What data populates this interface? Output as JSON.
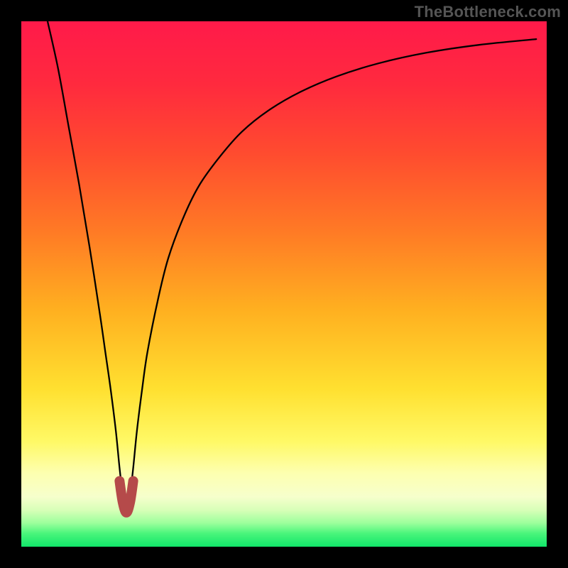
{
  "attribution": "TheBottleneck.com",
  "colors": {
    "frame": "#000000",
    "curve": "#000000",
    "marker": "#b54a4a",
    "gradient_stops": [
      {
        "offset": 0.0,
        "color": "#ff1a4a"
      },
      {
        "offset": 0.12,
        "color": "#ff2a3e"
      },
      {
        "offset": 0.25,
        "color": "#ff4b2f"
      },
      {
        "offset": 0.4,
        "color": "#ff7a25"
      },
      {
        "offset": 0.55,
        "color": "#ffb020"
      },
      {
        "offset": 0.7,
        "color": "#ffe030"
      },
      {
        "offset": 0.8,
        "color": "#fff966"
      },
      {
        "offset": 0.86,
        "color": "#fdffb0"
      },
      {
        "offset": 0.905,
        "color": "#f6ffcc"
      },
      {
        "offset": 0.93,
        "color": "#d8ffb8"
      },
      {
        "offset": 0.955,
        "color": "#9cff9c"
      },
      {
        "offset": 0.975,
        "color": "#49f57b"
      },
      {
        "offset": 1.0,
        "color": "#11e66a"
      }
    ]
  },
  "chart_data": {
    "type": "line",
    "title": "",
    "xlabel": "",
    "ylabel": "",
    "x_range": [
      0,
      100
    ],
    "y_range": [
      0,
      100
    ],
    "minimum_at_x": 20,
    "series": [
      {
        "name": "bottleneck-curve",
        "x": [
          5,
          7,
          9,
          11,
          13,
          15,
          16,
          17,
          18,
          18.7,
          19.3,
          20,
          20.7,
          21.3,
          22,
          23,
          24,
          26,
          28,
          31,
          34,
          38,
          42,
          47,
          53,
          60,
          68,
          77,
          87,
          98
        ],
        "y": [
          100,
          91,
          80,
          69,
          57,
          44,
          37,
          30,
          22,
          15,
          10,
          6.5,
          10,
          15,
          22,
          30,
          37,
          47,
          55,
          63,
          69,
          74.5,
          79,
          83,
          86.5,
          89.5,
          92,
          94,
          95.5,
          96.6
        ]
      }
    ],
    "marker": {
      "shape": "u",
      "center_x": 20,
      "points": [
        {
          "x": 18.7,
          "y": 12.5
        },
        {
          "x": 19.3,
          "y": 8.5
        },
        {
          "x": 20.0,
          "y": 6.5
        },
        {
          "x": 20.7,
          "y": 8.5
        },
        {
          "x": 21.3,
          "y": 12.5
        }
      ]
    }
  }
}
